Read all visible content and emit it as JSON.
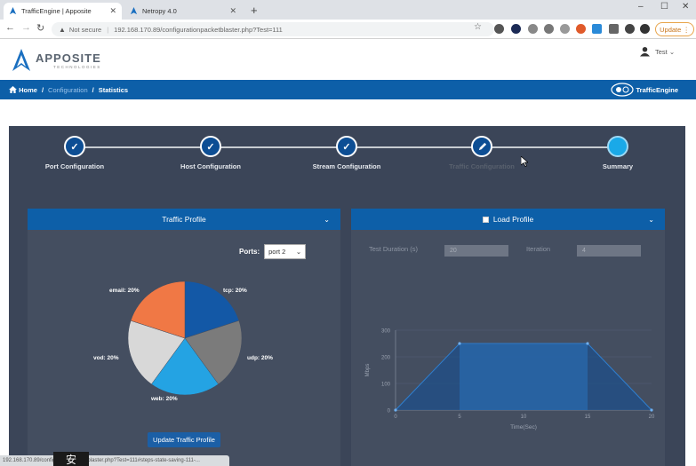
{
  "browser": {
    "tabs": [
      {
        "title": "TrafficEngine | Apposite",
        "active": true
      },
      {
        "title": "Netropy 4.0",
        "active": false
      }
    ],
    "address": {
      "warning": "Not secure",
      "url": "192.168.170.89/configurationpacketblaster.php?Test=111"
    },
    "update_label": "Update",
    "new_tab": "+",
    "status_url": "192.168.170.89/configurationpacketblaster.php?Test=111#steps-state-saving-111-..."
  },
  "header": {
    "logo_name": "APPOSITE",
    "logo_sub": "TECHNOLOGIES",
    "user_name": "Test"
  },
  "breadcrumb": {
    "home": "Home",
    "configuration": "Configuration",
    "current": "Statistics",
    "product": "TrafficEngine"
  },
  "wizard": {
    "steps": [
      {
        "label": "Port Configuration",
        "state": "done"
      },
      {
        "label": "Host Configuration",
        "state": "done"
      },
      {
        "label": "Stream Configuration",
        "state": "done"
      },
      {
        "label": "Traffic Configuration",
        "state": "editing"
      },
      {
        "label": "Summary",
        "state": "current"
      }
    ]
  },
  "traffic_profile": {
    "title": "Traffic Profile",
    "ports_label": "Ports:",
    "ports_value": "port 2",
    "update_button": "Update Traffic Profile"
  },
  "load_profile": {
    "title": "Load Profile",
    "test_duration_label": "Test Duration (s)",
    "test_duration_value": "20",
    "iteration_label": "Iteration",
    "iteration_value": "4"
  },
  "overlay_text": "安",
  "colors": {
    "blue": "#0d5fa8",
    "panel": "#3b4558",
    "card": "#444e60"
  },
  "chart_data": [
    {
      "type": "pie",
      "categories": [
        "tcp",
        "udp",
        "web",
        "vod",
        "email"
      ],
      "values": [
        20,
        20,
        20,
        20,
        20
      ],
      "labels": [
        "tcp: 20%",
        "udp: 20%",
        "web: 20%",
        "vod: 20%",
        "email: 20%"
      ],
      "colors": [
        "#1358a6",
        "#7b7b7b",
        "#24a3e3",
        "#d8d8d8",
        "#f07845"
      ]
    },
    {
      "type": "area",
      "x": [
        0,
        5,
        15,
        20
      ],
      "y": [
        0,
        250,
        250,
        0
      ],
      "xticks": [
        "0",
        "5",
        "10",
        "15",
        "20"
      ],
      "yticks": [
        "0",
        "100",
        "200",
        "300"
      ],
      "xlabel": "Time(Sec)",
      "ylabel": "Mbps",
      "xlim": [
        0,
        20
      ],
      "ylim": [
        0,
        300
      ]
    }
  ]
}
